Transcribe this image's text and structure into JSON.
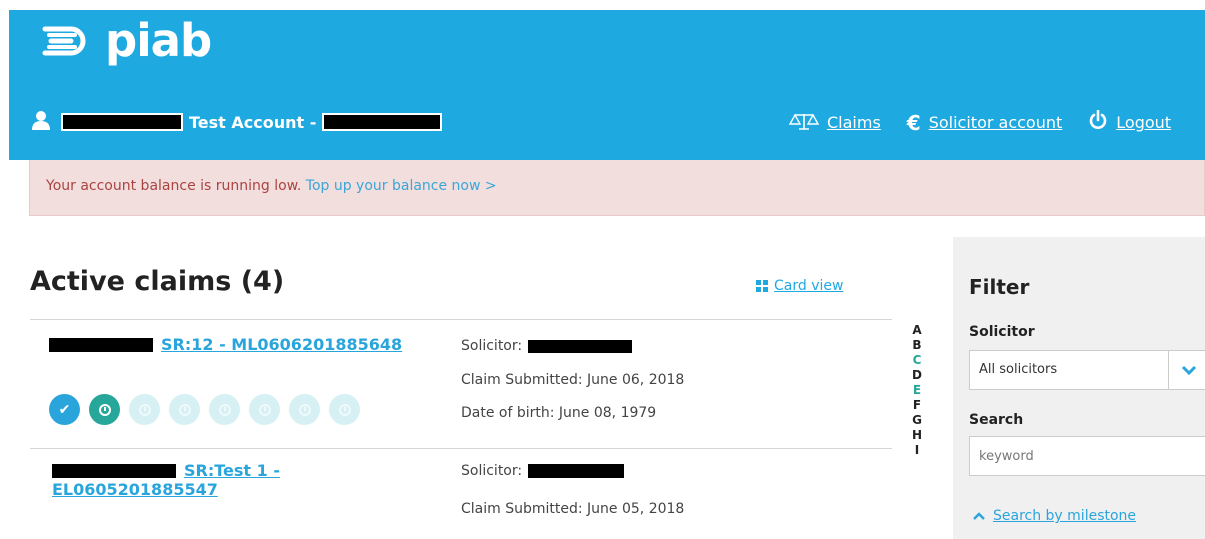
{
  "header": {
    "logo_text": "piab",
    "account_name": "Test Account -",
    "nav": [
      {
        "label": "Claims",
        "icon": "scales-icon"
      },
      {
        "label": "Solicitor account",
        "icon": "euro-icon"
      },
      {
        "label": "Logout",
        "icon": "power-icon"
      }
    ]
  },
  "alert": {
    "message": "Your account balance is running low.",
    "link": "Top up your balance now >"
  },
  "main": {
    "title": "Active claims (4)",
    "card_view_label": "Card view",
    "claims": [
      {
        "title": "SR:12 - ML0606201885648",
        "solicitor_label": "Solicitor:",
        "submitted": "Claim Submitted: June 06, 2018",
        "dob": "Date of birth: June 08, 1979",
        "milestones": [
          "done",
          "active",
          "pending",
          "pending",
          "pending",
          "pending",
          "pending",
          "pending"
        ]
      },
      {
        "title_line1": "SR:Test 1 -",
        "title_line2": "EL0605201885547",
        "solicitor_label": "Solicitor:",
        "submitted": "Claim Submitted: June 05, 2018"
      }
    ],
    "alphabet": [
      "A",
      "B",
      "C",
      "D",
      "E",
      "F",
      "G",
      "H",
      "I"
    ]
  },
  "filter": {
    "title": "Filter",
    "solicitor_label": "Solicitor",
    "solicitor_value": "All solicitors",
    "search_label": "Search",
    "search_placeholder": "keyword",
    "milestone_link": "Search by milestone"
  },
  "colors": {
    "brand": "#1fa9e1",
    "alert_bg": "#f3dede",
    "alert_text": "#a94442",
    "teal": "#27a69a"
  }
}
